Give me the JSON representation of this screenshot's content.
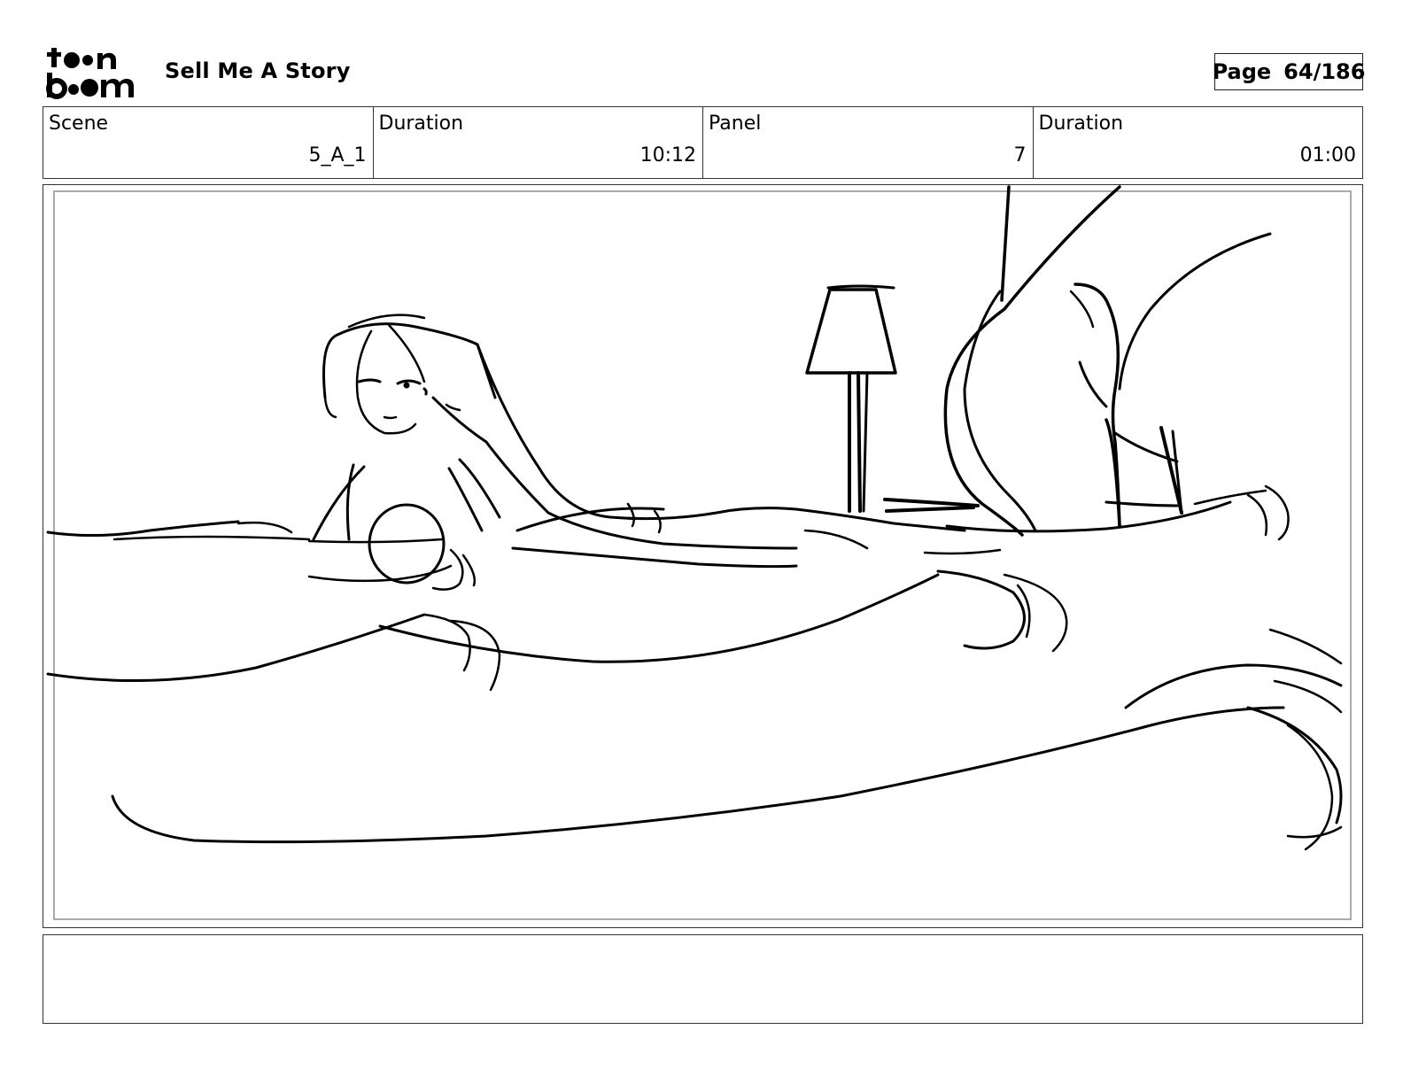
{
  "header": {
    "logo_text": "toonboom",
    "project_title": "Sell Me A Story",
    "page_label": "Page",
    "page_number": "64/186"
  },
  "info": {
    "scene_label": "Scene",
    "scene_value": "5_A_1",
    "scene_duration_label": "Duration",
    "scene_duration_value": "10:12",
    "panel_label": "Panel",
    "panel_value": "7",
    "panel_duration_label": "Duration",
    "panel_duration_value": "01:00"
  },
  "panel": {
    "image_icon": "storyboard-sketch"
  },
  "notes": {
    "text": ""
  }
}
